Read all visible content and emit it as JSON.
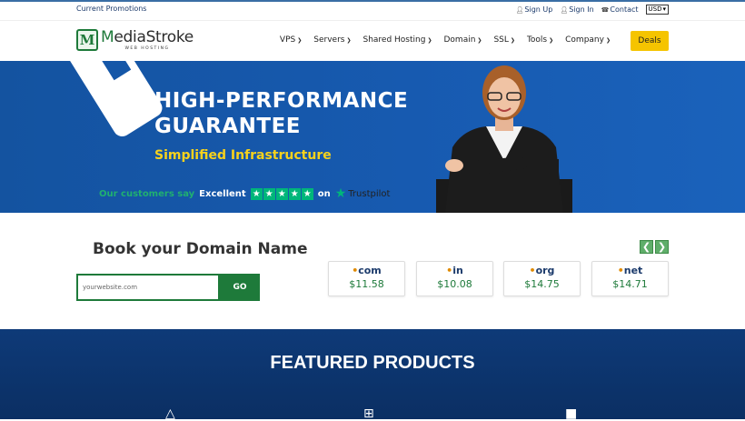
{
  "topbar": {
    "promo": "Current Promotions",
    "signup": "Sign Up",
    "signin": "Sign In",
    "contact": "Contact",
    "currency": "USD"
  },
  "nav": {
    "logo_name_prefix": "M",
    "logo_name_rest": "ediaStroke",
    "logo_sub": "WEB HOSTING",
    "items": [
      {
        "label": "VPS"
      },
      {
        "label": "Servers"
      },
      {
        "label": "Shared Hosting"
      },
      {
        "label": "Domain"
      },
      {
        "label": "SSL"
      },
      {
        "label": "Tools"
      },
      {
        "label": "Company"
      }
    ],
    "deals": "Deals"
  },
  "hero": {
    "line1": "HIGH-PERFORMANCE",
    "line2": "GUARANTEE",
    "subtitle": "Simplified Infrastructure",
    "trust_lead": "Our customers say",
    "trust_rating": "Excellent",
    "trust_on": "on",
    "trust_brand": "Trustpilot"
  },
  "domain": {
    "heading": "Book your Domain Name",
    "placeholder": "yourwebsite.com",
    "go": "GO",
    "tlds": [
      {
        "name": "com",
        "price": "$11.58"
      },
      {
        "name": "in",
        "price": "$10.08"
      },
      {
        "name": "org",
        "price": "$14.75"
      },
      {
        "name": "net",
        "price": "$14.71"
      }
    ]
  },
  "featured": {
    "title": "FEATURED PRODUCTS"
  }
}
